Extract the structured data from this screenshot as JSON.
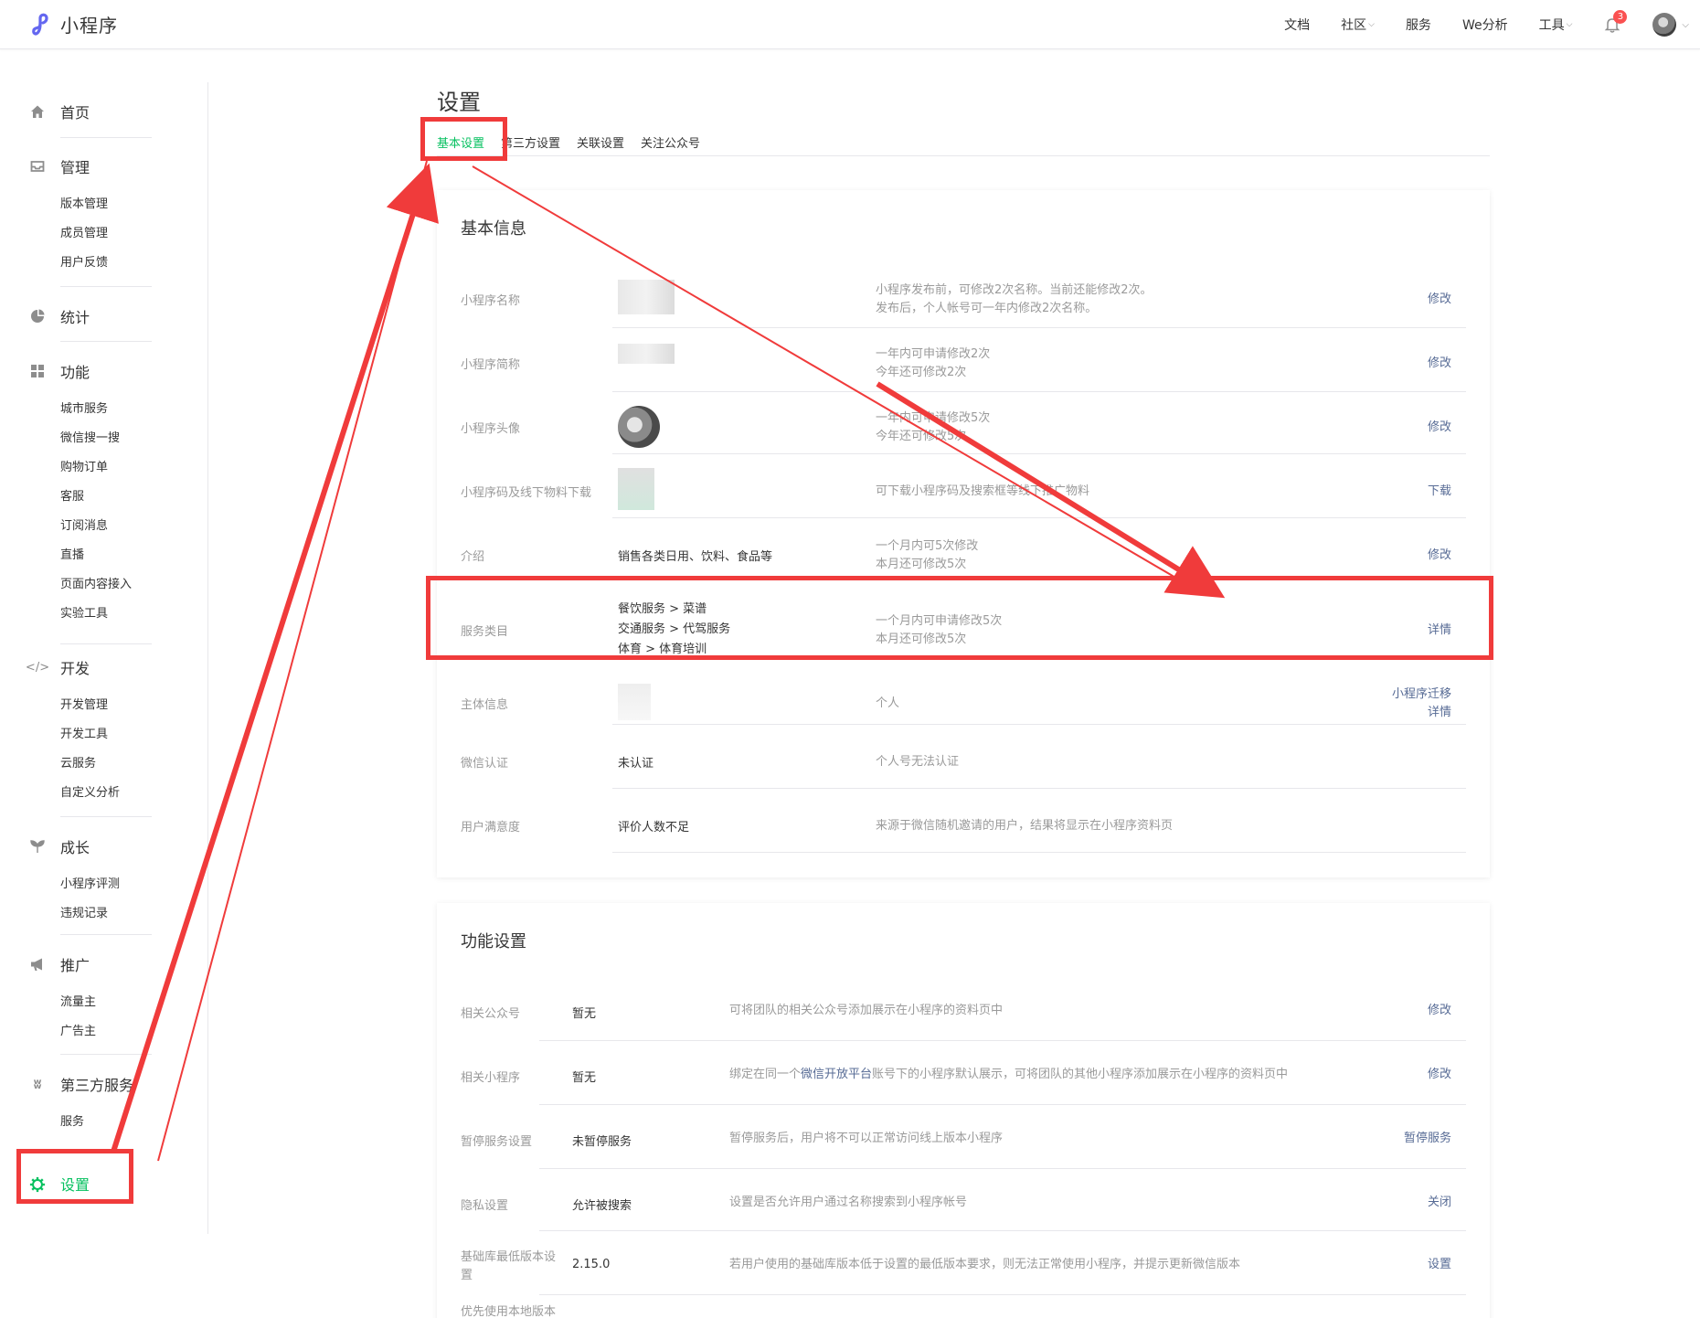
{
  "brand": {
    "name": "小程序"
  },
  "topnav": {
    "items": [
      "文档",
      "社区",
      "服务",
      "We分析",
      "工具"
    ],
    "notification_count": "3"
  },
  "sidebar": {
    "groups": [
      {
        "label": "首页",
        "icon": "home-icon",
        "items": []
      },
      {
        "label": "管理",
        "icon": "inbox-icon",
        "items": [
          "版本管理",
          "成员管理",
          "用户反馈"
        ]
      },
      {
        "label": "统计",
        "icon": "pie-chart-icon",
        "items": []
      },
      {
        "label": "功能",
        "icon": "grid-icon",
        "items": [
          "城市服务",
          "微信搜一搜",
          "购物订单",
          "客服",
          "订阅消息",
          "直播",
          "页面内容接入",
          "实验工具"
        ]
      },
      {
        "label": "开发",
        "icon": "code-icon",
        "items": [
          "开发管理",
          "开发工具",
          "云服务",
          "自定义分析"
        ]
      },
      {
        "label": "成长",
        "icon": "sprout-icon",
        "items": [
          "小程序评测",
          "违规记录"
        ]
      },
      {
        "label": "推广",
        "icon": "megaphone-icon",
        "items": [
          "流量主",
          "广告主"
        ]
      },
      {
        "label": "第三方服务",
        "icon": "third-party-icon",
        "items": [
          "服务"
        ]
      }
    ],
    "settings_label": "设置"
  },
  "page": {
    "title": "设置",
    "tabs": [
      "基本设置",
      "第三方设置",
      "关联设置",
      "关注公众号"
    ]
  },
  "basic_info": {
    "title": "基本信息",
    "rows": [
      {
        "label": "小程序名称",
        "value": "",
        "desc": [
          "小程序发布前，可修改2次名称。当前还能修改2次。",
          "发布后，个人帐号可一年内修改2次名称。"
        ],
        "actions": [
          "修改"
        ]
      },
      {
        "label": "小程序简称",
        "value": "",
        "desc": [
          "一年内可申请修改2次",
          "今年还可修改2次"
        ],
        "actions": [
          "修改"
        ]
      },
      {
        "label": "小程序头像",
        "value": "",
        "desc": [
          "一年内可申请修改5次",
          "今年还可修改5次"
        ],
        "actions": [
          "修改"
        ]
      },
      {
        "label": "小程序码及线下物料下载",
        "value": "",
        "desc": [
          "可下载小程序码及搜索框等线下推广物料"
        ],
        "actions": [
          "下载"
        ]
      },
      {
        "label": "介绍",
        "value": "销售各类日用、饮料、食品等",
        "desc": [
          "一个月内可5次修改",
          "本月还可修改5次"
        ],
        "actions": [
          "修改"
        ]
      },
      {
        "label": "服务类目",
        "value_lines": [
          "餐饮服务 > 菜谱",
          "交通服务 > 代驾服务",
          "体育 > 体育培训"
        ],
        "desc": [
          "一个月内可申请修改5次",
          "本月还可修改5次"
        ],
        "actions": [
          "详情"
        ]
      },
      {
        "label": "主体信息",
        "value": "",
        "desc": [
          "个人"
        ],
        "actions": [
          "小程序迁移",
          "详情"
        ]
      },
      {
        "label": "微信认证",
        "value": "未认证",
        "desc": [
          "个人号无法认证"
        ],
        "actions": []
      },
      {
        "label": "用户满意度",
        "value": "评价人数不足",
        "desc": [
          "来源于微信随机邀请的用户，结果将显示在小程序资料页"
        ],
        "actions": []
      }
    ]
  },
  "func_settings": {
    "title": "功能设置",
    "rows": [
      {
        "label": "相关公众号",
        "value": "暂无",
        "desc": "可将团队的相关公众号添加展示在小程序的资料页中",
        "action": "修改"
      },
      {
        "label": "相关小程序",
        "value": "暂无",
        "desc_pre": "绑定在同一个",
        "desc_link": "微信开放平台",
        "desc_post": "账号下的小程序默认展示，可将团队的其他小程序添加展示在小程序的资料页中",
        "action": "修改"
      },
      {
        "label": "暂停服务设置",
        "value": "未暂停服务",
        "desc": "暂停服务后，用户将不可以正常访问线上版本小程序",
        "action": "暂停服务"
      },
      {
        "label": "隐私设置",
        "value": "允许被搜索",
        "desc": "设置是否允许用户通过名称搜索到小程序帐号",
        "action": "关闭"
      },
      {
        "label": "基础库最低版本设置",
        "value": "2.15.0",
        "desc": "若用户使用的基础库版本低于设置的最低版本要求，则无法正常使用小程序，并提示更新微信版本",
        "action": "设置"
      },
      {
        "label": "优先使用本地版本",
        "value": "",
        "desc": "",
        "action": ""
      }
    ]
  },
  "colors": {
    "accent": "#07c160",
    "link": "#576b95",
    "annotation": "#f03b3b"
  }
}
